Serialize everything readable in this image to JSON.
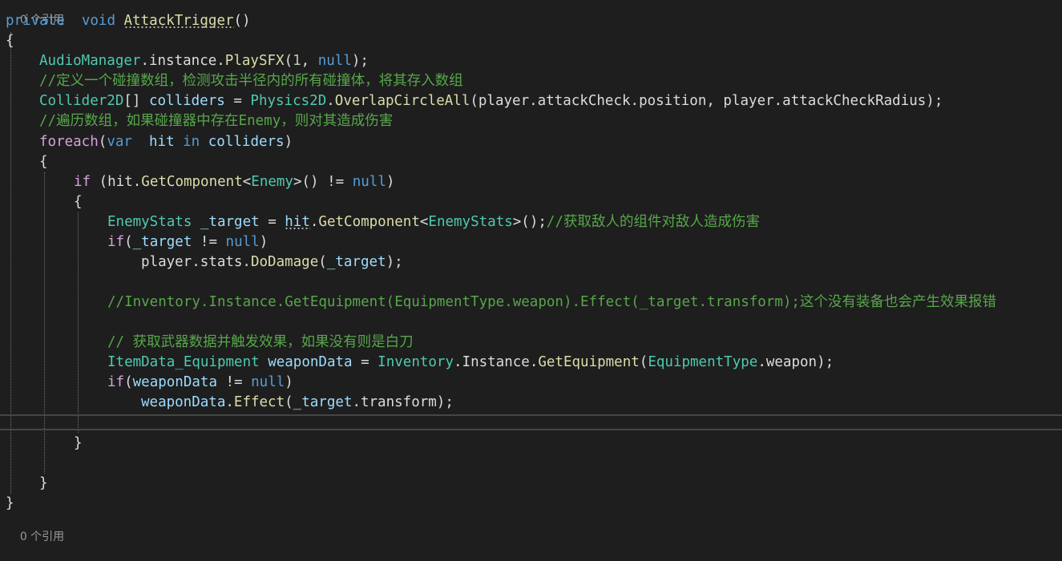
{
  "codelens": {
    "top_label": "0 个引用",
    "bottom_label": "0 个引用"
  },
  "code": {
    "l1_private": "private",
    "l1_void": "void",
    "l1_name": "AttackTrigger",
    "l1_parens": "()",
    "l2_brace": "{",
    "l3_class": "AudioManager",
    "l3_rest1": ".instance.",
    "l3_fn": "PlaySFX",
    "l3_open": "(",
    "l3_num": "1",
    "l3_comma": ", ",
    "l3_null": "null",
    "l3_close": ");",
    "l4_comment": "//定义一个碰撞数组，检测攻击半径内的所有碰撞体，将其存入数组",
    "l5_type": "Collider2D",
    "l5_brackets": "[] ",
    "l5_var": "colliders",
    "l5_eq": " = ",
    "l5_class": "Physics2D",
    "l5_dot": ".",
    "l5_fn": "OverlapCircleAll",
    "l5_args": "(player.attackCheck.position, player.attackCheckRadius);",
    "l6_comment": "//遍历数组，如果碰撞器中存在Enemy，则对其造成伤害",
    "l7_foreach": "foreach",
    "l7_open": "(",
    "l7_var": "var",
    "l7_sp": "  ",
    "l7_hit": "hit",
    "l7_in": " in ",
    "l7_coll": "colliders",
    "l7_close": ")",
    "l8_brace": "{",
    "l9_if": "if",
    "l9_open": " (hit.",
    "l9_fn": "GetComponent",
    "l9_lt": "<",
    "l9_type": "Enemy",
    "l9_rest": ">() != ",
    "l9_null": "null",
    "l9_close": ")",
    "l10_brace": "{",
    "l11_type": "EnemyStats",
    "l11_var": " _target",
    "l11_eq": " = ",
    "l11_hit": "hit",
    "l11_dot": ".",
    "l11_fn": "GetComponent",
    "l11_lt": "<",
    "l11_type2": "EnemyStats",
    "l11_rest": ">();",
    "l11_comment": "//获取敌人的组件对敌人造成伤害",
    "l12_if": "if",
    "l12_open": "(",
    "l12_var": "_target",
    "l12_ne": " != ",
    "l12_null": "null",
    "l12_close": ")",
    "l13_pre": "player.stats.",
    "l13_fn": "DoDamage",
    "l13_open": "(",
    "l13_var": "_target",
    "l13_close": ");",
    "l15_comment": "//Inventory.Instance.GetEquipment(EquipmentType.weapon).Effect(_target.transform);这个没有装备也会产生效果报错",
    "l17_comment": "// 获取武器数据并触发效果，如果没有则是白刀",
    "l18_type": "ItemData_Equipment",
    "l18_var": " weaponData",
    "l18_eq": " = ",
    "l18_class": "Inventory",
    "l18_mid": ".Instance.",
    "l18_fn": "GetEquipment",
    "l18_open": "(",
    "l18_enum": "EquipmentType",
    "l18_rest": ".weapon);",
    "l19_if": "if",
    "l19_open": "(",
    "l19_var": "weaponData",
    "l19_ne": " != ",
    "l19_null": "null",
    "l19_close": ")",
    "l20_var": "weaponData",
    "l20_dot": ".",
    "l20_fn": "Effect",
    "l20_open": "(",
    "l20_var2": "_target",
    "l20_rest": ".transform);",
    "l22_brace": "}",
    "l24_brace": "}",
    "l25_brace": "}"
  },
  "colors": {
    "background": "#1e1e1e",
    "keyword": "#569cd6",
    "type": "#4ec9b0",
    "function": "#dcdcaa",
    "comment": "#57a64a",
    "variable": "#9cdcfe",
    "number": "#b5cea8",
    "plain": "#dcdcdc"
  }
}
